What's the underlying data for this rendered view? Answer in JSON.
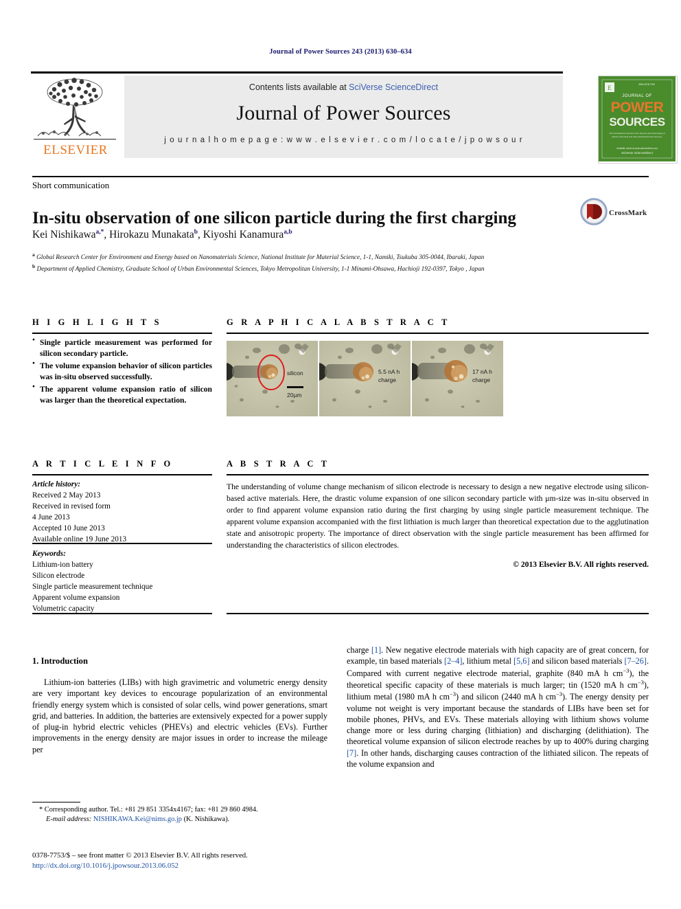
{
  "running_head": "Journal of Power Sources 243 (2013) 630–634",
  "masthead": {
    "contents_prefix": "Contents lists available at ",
    "contents_link": "SciVerse ScienceDirect",
    "journal_title": "Journal of Power Sources",
    "homepage": "j o u r n a l   h o m e p a g e :   w w w . e l s e v i e r . c o m / l o c a t e / j p o w s o u r",
    "publisher": "ELSEVIER",
    "cover": {
      "line1": "JOURNAL OF",
      "line2": "POWER",
      "line3": "SOURCES",
      "blurb": "The International Journal on the Science and Technology of Electrochemical Energy Systems",
      "footer": "Available online at\nSciVerse ScienceDirect"
    }
  },
  "article": {
    "type": "Short communication",
    "title": "In-situ observation of one silicon particle during the first charging",
    "authors": "Kei Nishikawa, Hirokazu Munakata, Kiyoshi Kanamura",
    "author_list": [
      {
        "name": "Kei Nishikawa",
        "marks": "a,*"
      },
      {
        "name": "Hirokazu Munakata",
        "marks": "b"
      },
      {
        "name": "Kiyoshi Kanamura",
        "marks": "a,b"
      }
    ],
    "affiliations": [
      {
        "mark": "a",
        "text": "Global Research Center for Environment and Energy based on Nanomaterials Science, National Institute for Material Science, 1-1, Namiki, Tsukuba 305-0044, Ibaraki, Japan"
      },
      {
        "mark": "b",
        "text": "Department of Applied Chemistry, Graduate School of Urban Environmental Sciences, Tokyo Metropolitan University, 1-1 Minami-Ohsawa, Hachioji 192-0397, Tokyo , Japan"
      }
    ],
    "crossmark_label": "CrossMark"
  },
  "highlights": {
    "heading": "H I G H L I G H T S",
    "items": [
      "Single particle measurement was performed for silicon secondary particle.",
      "The volume expansion behavior of silicon particles was in-situ observed successfully.",
      "The apparent volume expansion ratio of silicon was larger than the theoretical expectation."
    ]
  },
  "graphical_abstract": {
    "heading": "G R A P H I C A L   A B S T R A C T",
    "panels": [
      {
        "labels": [
          "silicon"
        ],
        "scalebar": "20μm",
        "annotation": ""
      },
      {
        "labels": [
          "5.5 nA h",
          "charge"
        ],
        "scalebar": "",
        "annotation": ""
      },
      {
        "labels": [
          "17 nA h",
          "charge"
        ],
        "scalebar": "",
        "annotation": ""
      }
    ]
  },
  "article_info": {
    "heading": "A R T I C L E   I N F O",
    "history_label": "Article history:",
    "history": [
      "Received 2 May 2013",
      "Received in revised form",
      "4 June 2013",
      "Accepted 10 June 2013",
      "Available online 19 June 2013"
    ],
    "keywords_label": "Keywords:",
    "keywords": [
      "Lithium-ion battery",
      "Silicon electrode",
      "Single particle measurement technique",
      "Apparent volume expansion",
      "Volumetric capacity"
    ]
  },
  "abstract": {
    "heading": "A B S T R A C T",
    "text": "The understanding of volume change mechanism of silicon electrode is necessary to design a new negative electrode using silicon-based active materials. Here, the drastic volume expansion of one silicon secondary particle with μm-size was in-situ observed in order to find apparent volume expansion ratio during the first charging by using single particle measurement technique. The apparent volume expansion accompanied with the first lithiation is much larger than theoretical expectation due to the agglutination state and anisotropic property. The importance of direct observation with the single particle measurement has been affirmed for understanding the characteristics of silicon electrodes.",
    "copyright": "© 2013 Elsevier B.V. All rights reserved."
  },
  "body": {
    "section1_heading": "1.  Introduction",
    "left_paragraph": "Lithium-ion batteries (LIBs) with high gravimetric and volumetric energy density are very important key devices to encourage popularization of an environmental friendly energy system which is consisted of solar cells, wind power generations, smart grid, and batteries. In addition, the batteries are extensively expected for a power supply of plug-in hybrid electric vehicles (PHEVs) and electric vehicles (EVs). Further improvements in the energy density are major issues in order to increase the mileage per"
  },
  "footnote": {
    "corresponding": "* Corresponding author. Tel.: +81 29 851 3354x4167; fax: +81 29 860 4984.",
    "email_label": "E-mail address:",
    "email": "NISHIKAWA.Kei@nims.go.jp",
    "email_suffix": "(K. Nishikawa)."
  },
  "imprint": {
    "line1": "0378-7753/$ – see front matter © 2013 Elsevier B.V. All rights reserved.",
    "doi": "http://dx.doi.org/10.1016/j.jpowsour.2013.06.052"
  },
  "colors": {
    "link": "#1a4d9e",
    "elsevier_orange": "#E87722",
    "cover_green": "#4a8b2c",
    "crossmark_red": "#b32b22",
    "band_gray": "#ebebeb"
  }
}
